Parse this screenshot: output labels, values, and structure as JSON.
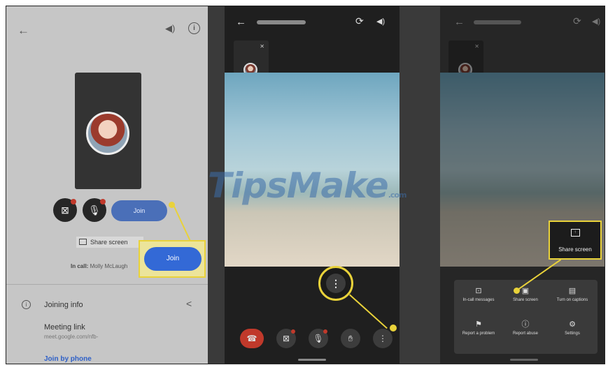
{
  "panel1": {
    "join_button": "Join",
    "join_button_highlight": "Join",
    "share_screen": "Share screen",
    "in_call_label": "In call:",
    "in_call_names": "Molly McLaugh",
    "joining_info": "Joining info",
    "meeting_link_label": "Meeting link",
    "meeting_link_value": "meet.google.com/nfb-",
    "join_by_phone": "Join by phone"
  },
  "panel2": {
    "more_options_glyph": "⋮"
  },
  "panel3": {
    "share_screen_highlight": "Share screen",
    "menu_items": [
      {
        "icon": "chat-icon",
        "glyph": "⊡",
        "label": "In-call messages"
      },
      {
        "icon": "share-screen-icon",
        "glyph": "▣",
        "label": "Share screen"
      },
      {
        "icon": "captions-icon",
        "glyph": "▤",
        "label": "Turn on captions"
      },
      {
        "icon": "report-problem-icon",
        "glyph": "⚑",
        "label": "Report a problem"
      },
      {
        "icon": "report-abuse-icon",
        "glyph": "ⓘ",
        "label": "Report abuse"
      },
      {
        "icon": "settings-icon",
        "glyph": "⚙",
        "label": "Settings"
      }
    ]
  },
  "watermark": {
    "text": "TipsMake",
    "suffix": ".com"
  },
  "colors": {
    "highlight": "#e9d23a",
    "join_blue": "#3369d6",
    "end_call_red": "#c0392b"
  }
}
